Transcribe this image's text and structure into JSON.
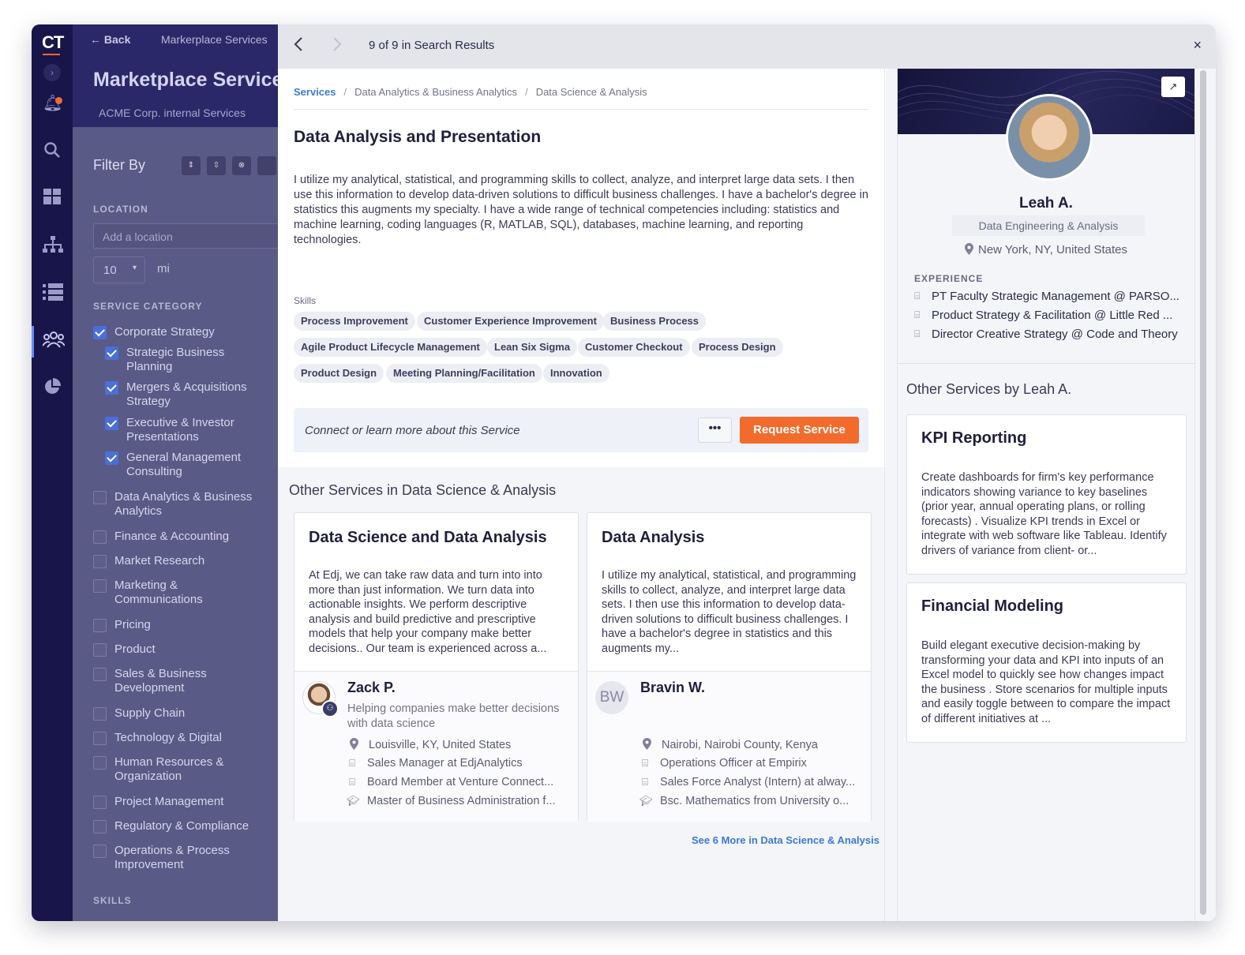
{
  "app": {
    "logo": "CT"
  },
  "underlying": {
    "back": "← Back",
    "crumb": "Markerplace Services",
    "title": "Marketplace Services",
    "subtitle": "ACME Corp. internal Services",
    "filter_by": "Filter By",
    "location_label": "LOCATION",
    "location_placeholder": "Add a location",
    "radius_value": "10",
    "radius_unit": "mi",
    "service_category_label": "SERVICE CATEGORY",
    "skills_label": "SKILLS",
    "categories": [
      {
        "label": "Corporate Strategy",
        "checked": true
      },
      {
        "label": "Strategic Business Planning",
        "checked": true
      },
      {
        "label": "Mergers & Acquisitions Strategy",
        "checked": true
      },
      {
        "label": "Executive & Investor Presentations",
        "checked": true
      },
      {
        "label": "General Management Consulting",
        "checked": true
      },
      {
        "label": "Data Analytics & Business Analytics",
        "checked": false
      },
      {
        "label": "Finance & Accounting",
        "checked": false
      },
      {
        "label": "Market Research",
        "checked": false
      },
      {
        "label": "Marketing & Communications",
        "checked": false
      },
      {
        "label": "Pricing",
        "checked": false
      },
      {
        "label": "Product",
        "checked": false
      },
      {
        "label": "Sales & Business Development",
        "checked": false
      },
      {
        "label": "Supply Chain",
        "checked": false
      },
      {
        "label": "Technology & Digital",
        "checked": false
      },
      {
        "label": "Human Resources & Organization",
        "checked": false
      },
      {
        "label": "Project Management",
        "checked": false
      },
      {
        "label": "Regulatory & Compliance",
        "checked": false
      },
      {
        "label": "Operations & Process Improvement",
        "checked": false
      }
    ]
  },
  "modal": {
    "result_count": "9 of 9 in Search Results",
    "close": "×",
    "breadcrumb": {
      "root": "Services",
      "level1": "Data Analytics & Business Analytics",
      "level2": "Data Science & Analysis"
    },
    "service": {
      "title": "Data Analysis and Presentation",
      "description": "I utilize my analytical, statistical, and programming skills to collect, analyze, and interpret large data sets. I then use this information to develop data-driven solutions to difficult business challenges. I have a bachelor's degree in statistics this augments my specialty. I have a wide range of technical competencies including: statistics and machine learning, coding languages (R, MATLAB, SQL), databases, machine learning, and reporting technologies.",
      "skills_label": "Skills",
      "skills": [
        "Process Improvement",
        "Customer Experience Improvement",
        "Business Process",
        "Agile Product Lifecycle Management",
        "Lean Six Sigma",
        "Customer Checkout",
        "Process Design",
        "Product Design",
        "Meeting Planning/Facilitation",
        "Innovation"
      ],
      "cta_text": "Connect or learn more about this Service",
      "more_label": "•••",
      "request_label": "Request Service"
    },
    "other_heading": "Other Services in Data Science & Analysis",
    "other_services": [
      {
        "title": "Data Science and Data Analysis",
        "description": "At Edj, we can take raw data and turn into into more than just information. We turn data into actionable insights. We perform descriptive analysis and build predictive and prescriptive models that help your company make better decisions.. Our team is experienced across a...",
        "provider": "Zack P.",
        "headline": "Helping companies make better decisions with data science",
        "location": "Louisville, KY, United States",
        "exp1": "Sales Manager at EdjAnalytics",
        "exp2": "Board Member at Venture Connect...",
        "edu": "Master of Business Administration f..."
      },
      {
        "title": "Data Analysis",
        "description": "I utilize my analytical, statistical, and programming skills to collect, analyze, and interpret large data sets. I then use this information to develop data-driven solutions to difficult business challenges. I have a bachelor's degree in statistics and this augments my...",
        "provider": "Bravin W.",
        "initials": "BW",
        "location": "Nairobi, Nairobi County, Kenya",
        "exp1": "Operations Officer at Empirix",
        "exp2": "Sales Force Analyst (Intern) at alway...",
        "edu": "Bsc. Mathematics from University o..."
      }
    ],
    "see_more": "See 6 More in Data Science & Analysis"
  },
  "profile": {
    "name": "Leah A.",
    "role": "Data Engineering & Analysis",
    "location": "New York, NY, United States",
    "experience_label": "EXPERIENCE",
    "experience": [
      "PT Faculty Strategic Management @ PARSO...",
      "Product Strategy & Facilitation @ Little Red ...",
      "Director Creative Strategy @ Code and Theory"
    ],
    "other_heading": "Other Services by Leah A.",
    "services": [
      {
        "title": "KPI Reporting",
        "description": "Create dashboards for firm's key performance indicators showing variance to key baselines (prior year, annual operating plans, or rolling forecasts) . Visualize KPI trends in Excel or integrate with web software like Tableau. Identify drivers of variance from client- or..."
      },
      {
        "title": "Financial Modeling",
        "description": "Build elegant executive decision-making by transforming your data and KPI into inputs of an Excel model to quickly see how changes impact the business . Store scenarios for multiple inputs and easily toggle between to compare the impact of different initiatives at ..."
      }
    ]
  }
}
